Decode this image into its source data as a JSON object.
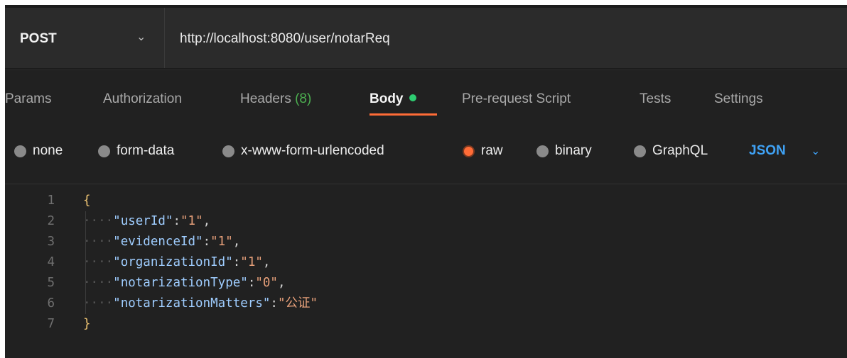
{
  "request": {
    "method": "POST",
    "url": "http://localhost:8080/user/notarReq"
  },
  "tabs": [
    {
      "label": "Params"
    },
    {
      "label": "Authorization"
    },
    {
      "label": "Headers",
      "count": "(8)"
    },
    {
      "label": "Body"
    },
    {
      "label": "Pre-request Script"
    },
    {
      "label": "Tests"
    },
    {
      "label": "Settings"
    }
  ],
  "body_types": [
    {
      "label": "none",
      "selected": false
    },
    {
      "label": "form-data",
      "selected": false
    },
    {
      "label": "x-www-form-urlencoded",
      "selected": false
    },
    {
      "label": "raw",
      "selected": true
    },
    {
      "label": "binary",
      "selected": false
    },
    {
      "label": "GraphQL",
      "selected": false
    }
  ],
  "language": "JSON",
  "editor": {
    "lines": [
      {
        "n": "1",
        "open": "{"
      },
      {
        "n": "2",
        "key": "\"userId\"",
        "value": "\"1\"",
        "tail": ","
      },
      {
        "n": "3",
        "key": "\"evidenceId\"",
        "value": "\"1\"",
        "tail": ","
      },
      {
        "n": "4",
        "key": "\"organizationId\"",
        "value": "\"1\"",
        "tail": ","
      },
      {
        "n": "5",
        "key": "\"notarizationType\"",
        "value": "\"0\"",
        "tail": ","
      },
      {
        "n": "6",
        "key": "\"notarizationMatters\"",
        "value": "\"公证\"",
        "tail": ""
      },
      {
        "n": "7",
        "close": "}"
      }
    ]
  },
  "colors": {
    "accent": "#ff6c37",
    "json_link": "#3fa2f5",
    "body_dot": "#2ecc71"
  }
}
